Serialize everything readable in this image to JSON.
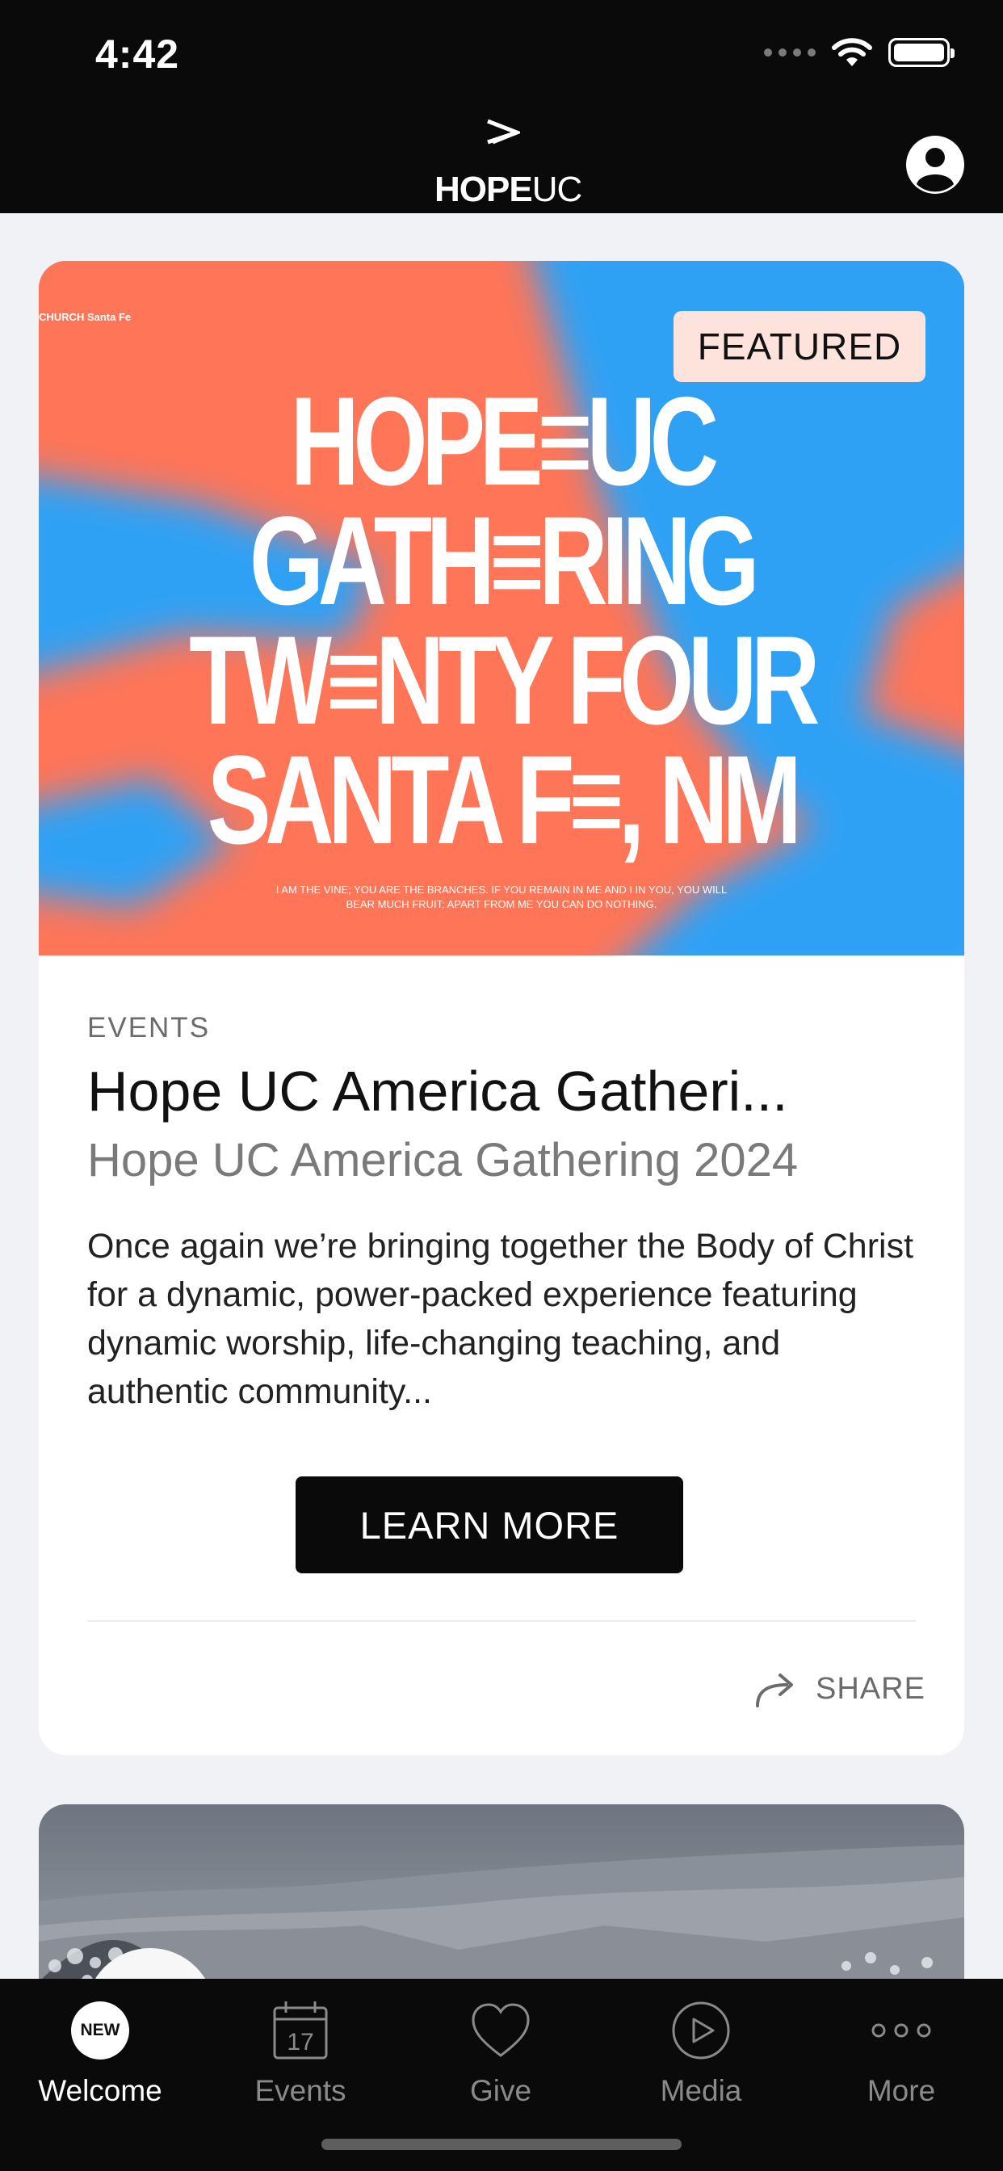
{
  "status_bar": {
    "time": "4:42"
  },
  "header": {
    "logo_bold": "HOPE",
    "logo_thin": "UC",
    "profile_icon": "user-circle-icon"
  },
  "featured_card": {
    "badge": "FEATURED",
    "hero": {
      "corner_text": "CHURCH Santa Fe",
      "title_lines": [
        "HOPE≡UC",
        "GATH≡RING",
        "TW≡NTY FOUR",
        "SANTA F≡, NM"
      ],
      "verse_line1": "I AM THE VINE; YOU ARE THE BRANCHES. IF YOU REMAIN IN ME AND I IN YOU, YOU WILL",
      "verse_line2": "BEAR MUCH FRUIT; APART FROM ME YOU CAN DO NOTHING."
    },
    "category": "EVENTS",
    "title": "Hope UC America Gatheri...",
    "subtitle": "Hope UC America Gathering 2024",
    "description": "Once again we’re bringing together the Body of Christ for a dynamic, power-packed experience featuring dynamic worship, life-changing teaching, and authentic community...",
    "button_label": "LEARN MORE",
    "share_label": "SHARE"
  },
  "tabs": [
    {
      "label": "Welcome",
      "icon": "new-badge-icon",
      "badge": "NEW",
      "active": true
    },
    {
      "label": "Events",
      "icon": "calendar-icon",
      "calendar_day": "17",
      "active": false
    },
    {
      "label": "Give",
      "icon": "heart-icon",
      "active": false
    },
    {
      "label": "Media",
      "icon": "play-icon",
      "active": false
    },
    {
      "label": "More",
      "icon": "more-dots-icon",
      "active": false
    }
  ],
  "colors": {
    "hero_orange": "#ff7558",
    "hero_blue": "#2ea1f5",
    "badge_bg": "#fde3dc",
    "header_bg": "#0a0a0a",
    "page_bg": "#f1f2f5"
  }
}
